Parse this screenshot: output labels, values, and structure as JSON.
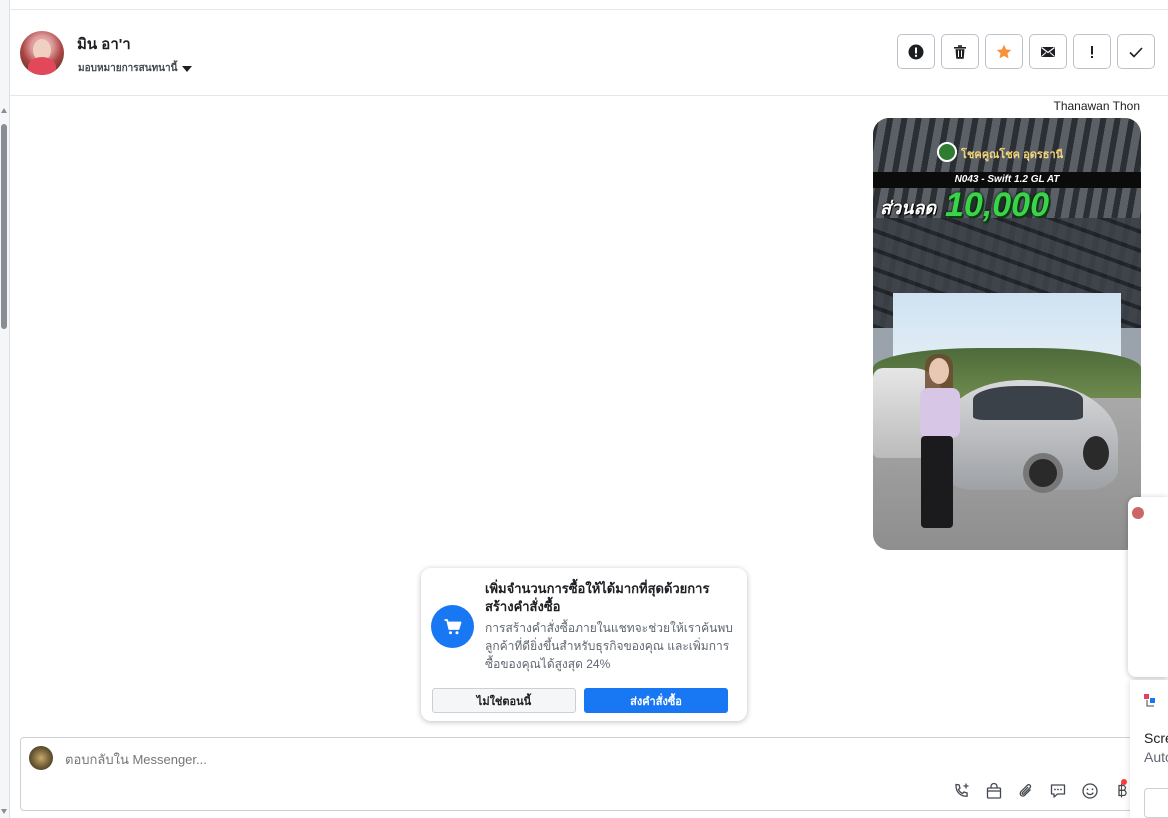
{
  "header": {
    "contact_name": "มิน อา'า",
    "assign_label": "มอบหมายการสนทนานี้",
    "actions": [
      {
        "name": "report-icon"
      },
      {
        "name": "trash-icon"
      },
      {
        "name": "star-icon"
      },
      {
        "name": "envelope-icon"
      },
      {
        "name": "exclamation-icon"
      },
      {
        "name": "check-icon"
      }
    ],
    "star_color": "#f7923b"
  },
  "conversation": {
    "sender_name": "Thanawan Thon",
    "media": {
      "brand_text": "โชคคูณโชค อุดรธานี",
      "model_text": "N043 - Swift 1.2 GL AT",
      "discount_label": "ส่วนลด",
      "discount_amount": "10,000"
    }
  },
  "promo": {
    "title": "เพิ่มจำนวนการซื้อให้ได้มากที่สุดด้วยการสร้างคำสั่งซื้อ",
    "body": "การสร้างคำสั่งซื้อภายในแชทจะช่วยให้เราค้นพบลูกค้าที่ดียิ่งขึ้นสำหรับธุรกิจของคุณ และเพิ่มการซื้อของคุณได้สูงสุด 24%",
    "not_now_label": "ไม่ใช่ตอนนี้",
    "create_label": "ส่งคำสั่งซื้อ",
    "accent_color": "#1877f2"
  },
  "composer": {
    "placeholder": "ตอบกลับใน Messenger..."
  },
  "side_panel": {
    "title_line1": "Scre",
    "title_line2": "Auto"
  }
}
